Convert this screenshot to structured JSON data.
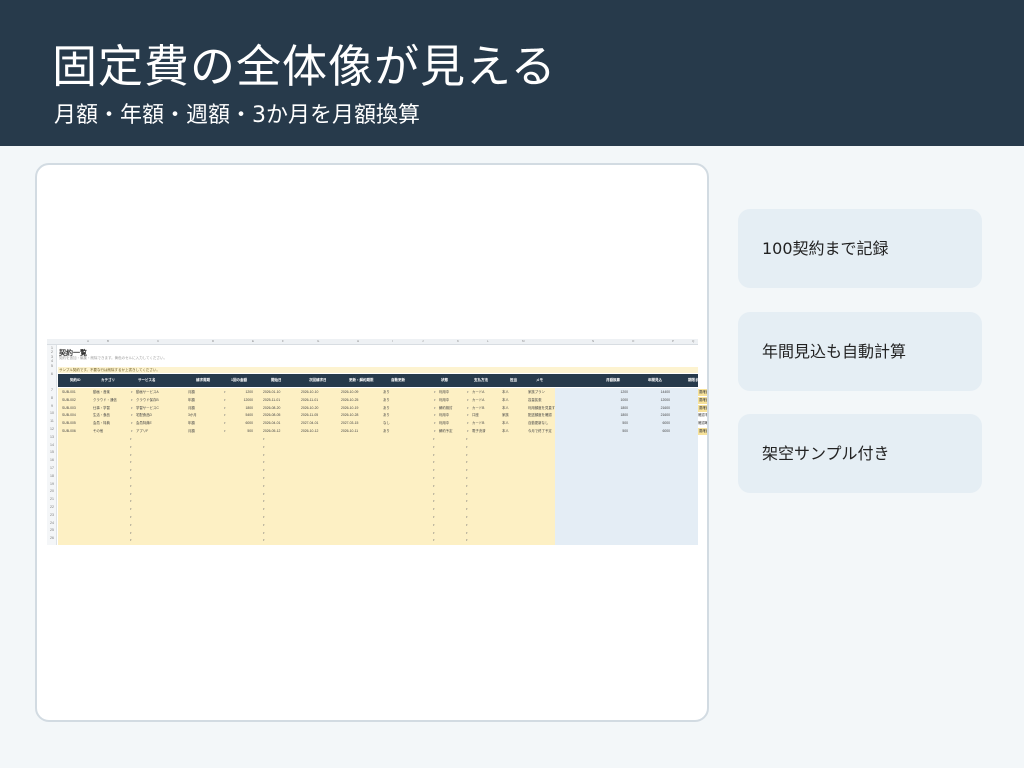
{
  "header": {
    "title": "固定費の全体像が見える",
    "subtitle": "月額・年額・週額・3か月を月額換算"
  },
  "features": [
    {
      "label": "100契約まで記録"
    },
    {
      "label": "年間見込も自動計算"
    },
    {
      "label": "架空サンプル付き"
    }
  ],
  "colors": {
    "header_bg": "#273a4b",
    "page_bg": "#f3f7f9",
    "feature_bg": "#e5eef4",
    "sheet_input_bg": "#fdf0c4",
    "sheet_calc_bg": "#e4edf5"
  },
  "sheet": {
    "title": "契約一覧",
    "description": "契約を追加・編集・削除できます。黄色のセルに入力してください。",
    "notice": "サンプル契約です。不要な行は削除するか上書きしてください。",
    "column_letters": [
      "A",
      "B",
      "C",
      "D",
      "E",
      "F",
      "G",
      "H",
      "I",
      "J",
      "K",
      "L",
      "M",
      "N",
      "O",
      "P",
      "Q"
    ],
    "row_numbers": [
      "1",
      "2",
      "3",
      "4",
      "5",
      "6",
      "7",
      "8",
      "9",
      "10",
      "11",
      "12",
      "13",
      "14",
      "15",
      "16",
      "17",
      "18",
      "19",
      "20",
      "21",
      "22",
      "23",
      "24",
      "25",
      "26"
    ],
    "headers": [
      "契約ID",
      "カテゴリ",
      "サービス名",
      "請求周期",
      "1回の金額",
      "開始日",
      "次回請求日",
      "更新・解約期限",
      "自動更新",
      "状態",
      "支払方法",
      "担当",
      "メモ",
      "月額換算",
      "年間見込",
      "期限まで",
      "確認状況"
    ],
    "rows": [
      [
        "SUB-001",
        "動画・音楽",
        "動画サービスA",
        "月額",
        "1200",
        "2026-01-10",
        "2026-10-10",
        "2026-10-09",
        "あり",
        "利用中",
        "カードA",
        "本人",
        "家族プラン",
        "1200",
        "14400",
        "12",
        "要確認"
      ],
      [
        "SUB-002",
        "クラウド・通信",
        "クラウド保存B",
        "年額",
        "12000",
        "2025-11-01",
        "2026-11-01",
        "2026-10-25",
        "あり",
        "利用中",
        "カードA",
        "本人",
        "容量拡張",
        "1000",
        "12000",
        "28",
        "要確認"
      ],
      [
        "SUB-003",
        "仕事・学習",
        "学習サービスC",
        "月額",
        "1800",
        "2026-08-20",
        "2026-10-20",
        "2026-10-19",
        "あり",
        "解約検討",
        "カードB",
        "本人",
        "利用頻度を見直す",
        "1800",
        "21600",
        "22",
        "要確認"
      ],
      [
        "SUB-004",
        "生活・食品",
        "宅配食品D",
        "3か月",
        "5400",
        "2026-08-05",
        "2026-11-05",
        "2026-10-28",
        "あり",
        "利用中",
        "口座",
        "家族",
        "配送頻度を確認",
        "1800",
        "21600",
        "32",
        "確認不要"
      ],
      [
        "SUB-005",
        "会員・特典",
        "会員特典E",
        "年額",
        "6000",
        "2026-04-01",
        "2027-04-01",
        "2027-03-15",
        "なし",
        "利用中",
        "カードB",
        "本人",
        "自動更新なし",
        "500",
        "6000",
        "166",
        "確認不要"
      ],
      [
        "SUB-006",
        "その他",
        "アプリF",
        "月額",
        "500",
        "2026-05-12",
        "2026-10-12",
        "2026-10-11",
        "あり",
        "解約予定",
        "電子決済",
        "本人",
        "今月で終了予定",
        "500",
        "6000",
        "14",
        "要確認"
      ]
    ]
  }
}
